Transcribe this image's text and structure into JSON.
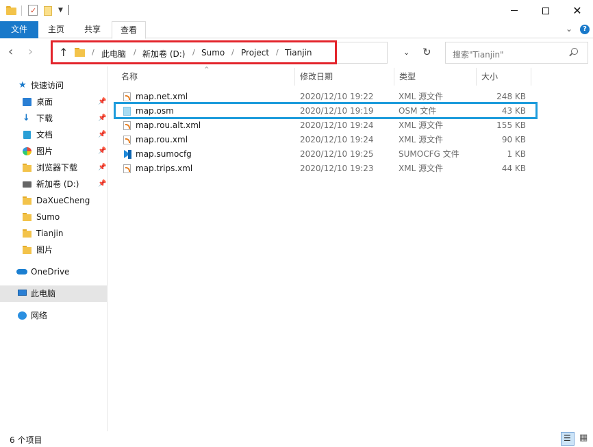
{
  "ribbon": {
    "tab_file": "文件",
    "tab_home": "主页",
    "tab_share": "共享",
    "tab_view": "查看",
    "help_glyph": "?"
  },
  "window": {
    "min_label": "",
    "close_glyph": "✕"
  },
  "address": {
    "crumbs": [
      "此电脑",
      "新加卷 (D:)",
      "Sumo",
      "Project",
      "Tianjin"
    ],
    "separator": "/"
  },
  "search": {
    "placeholder": "搜索\"Tianjin\""
  },
  "sidebar": {
    "quick_access": "快速访问",
    "items": [
      {
        "label": "桌面",
        "icon": "desktop-icon",
        "pinned": true
      },
      {
        "label": "下载",
        "icon": "download-icon",
        "pinned": true
      },
      {
        "label": "文档",
        "icon": "document-icon",
        "pinned": true
      },
      {
        "label": "图片",
        "icon": "pictures-icon",
        "pinned": true
      },
      {
        "label": "浏览器下载",
        "icon": "folder-icon",
        "pinned": true
      },
      {
        "label": "新加卷 (D:)",
        "icon": "drive-icon",
        "pinned": true
      },
      {
        "label": "DaXueCheng",
        "icon": "folder-icon",
        "pinned": false
      },
      {
        "label": "Sumo",
        "icon": "folder-icon",
        "pinned": false
      },
      {
        "label": "Tianjin",
        "icon": "folder-icon",
        "pinned": false
      },
      {
        "label": "图片",
        "icon": "folder-icon",
        "pinned": false
      }
    ],
    "onedrive": "OneDrive",
    "this_pc": "此电脑",
    "network": "网络"
  },
  "columns": {
    "name": "名称",
    "date": "修改日期",
    "type": "类型",
    "size": "大小"
  },
  "files": [
    {
      "name": "map.net.xml",
      "date": "2020/12/10 19:22",
      "type": "XML 源文件",
      "size": "248 KB",
      "icon": "xml-file-icon"
    },
    {
      "name": "map.osm",
      "date": "2020/12/10 19:19",
      "type": "OSM 文件",
      "size": "43 KB",
      "icon": "osm-file-icon"
    },
    {
      "name": "map.rou.alt.xml",
      "date": "2020/12/10 19:24",
      "type": "XML 源文件",
      "size": "155 KB",
      "icon": "xml-file-icon"
    },
    {
      "name": "map.rou.xml",
      "date": "2020/12/10 19:24",
      "type": "XML 源文件",
      "size": "90 KB",
      "icon": "xml-file-icon"
    },
    {
      "name": "map.sumocfg",
      "date": "2020/12/10 19:25",
      "type": "SUMOCFG 文件",
      "size": "1 KB",
      "icon": "vscode-file-icon"
    },
    {
      "name": "map.trips.xml",
      "date": "2020/12/10 19:23",
      "type": "XML 源文件",
      "size": "44 KB",
      "icon": "xml-file-icon"
    }
  ],
  "status": {
    "item_count": "6 个项目"
  },
  "colors": {
    "accent": "#1979ca",
    "address_highlight": "#e3242b",
    "row_highlight": "#1e9cdc"
  }
}
